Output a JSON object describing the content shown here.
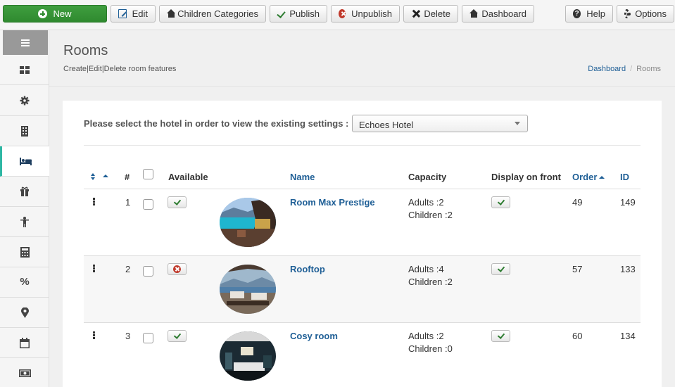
{
  "toolbar": {
    "new_label": "New",
    "edit_label": "Edit",
    "children_label": "Children Categories",
    "publish_label": "Publish",
    "unpublish_label": "Unpublish",
    "delete_label": "Delete",
    "dashboard_label": "Dashboard",
    "help_label": "Help",
    "options_label": "Options",
    "help_glyph": "?"
  },
  "page": {
    "title": "Rooms",
    "subtitle": "Create|Edit|Delete room features"
  },
  "breadcrumb": {
    "link": "Dashboard",
    "separator": "/",
    "current": "Rooms"
  },
  "filter": {
    "label": "Please select the hotel in order to view the existing settings :",
    "selected": "Echoes Hotel"
  },
  "table": {
    "headers": {
      "number": "#",
      "available": "Available",
      "name": "Name",
      "capacity": "Capacity",
      "display": "Display on front",
      "order": "Order",
      "id": "ID"
    },
    "rows": [
      {
        "num": "1",
        "available": "yes",
        "name": "Room Max Prestige",
        "adults": "Adults :2",
        "children": "Children :2",
        "display": "yes",
        "order": "49",
        "id": "149"
      },
      {
        "num": "2",
        "available": "no",
        "name": "Rooftop",
        "adults": "Adults :4",
        "children": "Children :2",
        "display": "yes",
        "order": "57",
        "id": "133"
      },
      {
        "num": "3",
        "available": "yes",
        "name": "Cosy room",
        "adults": "Adults :2",
        "children": "Children :0",
        "display": "yes",
        "order": "60",
        "id": "134"
      }
    ]
  },
  "sidebar": {
    "icons": [
      "dashboard-icon",
      "gear-icon",
      "building-icon",
      "bed-icon",
      "gift-icon",
      "person-icon",
      "calculator-icon",
      "percent-icon",
      "map-marker-icon",
      "calendar-icon",
      "money-icon"
    ],
    "active": "bed-icon",
    "percent_glyph": "%"
  },
  "colors": {
    "accent": "#2eb7a4",
    "link": "#1f5f96",
    "new_button": "#2f8a2f",
    "danger": "#c0392b"
  }
}
